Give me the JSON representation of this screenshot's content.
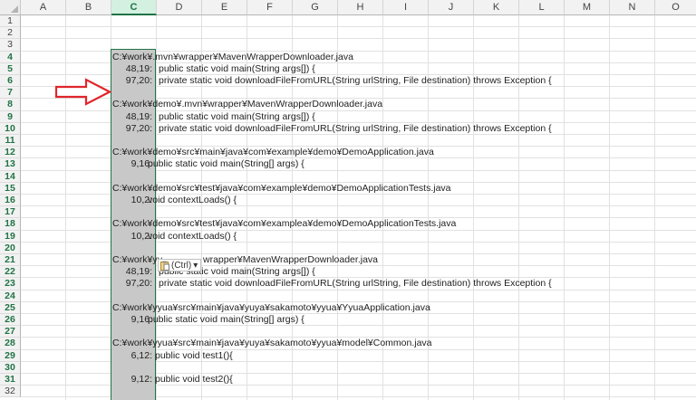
{
  "columns": [
    "A",
    "B",
    "C",
    "D",
    "E",
    "F",
    "G",
    "H",
    "I",
    "J",
    "K",
    "L",
    "M",
    "N",
    "O"
  ],
  "selected_column": "C",
  "rows": [
    {
      "n": "1"
    },
    {
      "n": "2"
    },
    {
      "n": "3"
    },
    {
      "n": "4",
      "path": "C:¥work¥.mvn¥wrapper¥MavenWrapperDownloader.java"
    },
    {
      "n": "5",
      "num": "48,19:",
      "code": "public static void main(String args[]) {",
      "indent": "m"
    },
    {
      "n": "6",
      "num": "97,20:",
      "code": "private static void downloadFileFromURL(String urlString, File destination) throws Exception {",
      "indent": "m"
    },
    {
      "n": "7"
    },
    {
      "n": "8",
      "path": "C:¥work¥demo¥.mvn¥wrapper¥MavenWrapperDownloader.java"
    },
    {
      "n": "9",
      "num": "48,19:",
      "code": "public static void main(String args[]) {",
      "indent": "m"
    },
    {
      "n": "10",
      "num": "97,20:",
      "code": "private static void downloadFileFromURL(String urlString, File destination) throws Exception {",
      "indent": "m"
    },
    {
      "n": "11"
    },
    {
      "n": "12",
      "path": "C:¥work¥demo¥src¥main¥java¥com¥example¥demo¥DemoApplication.java"
    },
    {
      "n": "13",
      "num": "9,16:",
      "code": "public static void main(String[] args) {",
      "indent": "s"
    },
    {
      "n": "14"
    },
    {
      "n": "15",
      "path": "C:¥work¥demo¥src¥test¥java¥com¥example¥demo¥DemoApplicationTests.java"
    },
    {
      "n": "16",
      "num": "10,2:",
      "code": "void contextLoads() {",
      "indent": "s"
    },
    {
      "n": "17"
    },
    {
      "n": "18",
      "path": "C:¥work¥demo¥src¥test¥java¥com¥examplea¥demo¥DemoApplicationTests.java"
    },
    {
      "n": "19",
      "num": "10,2:",
      "code": "void contextLoads() {",
      "indent": "s"
    },
    {
      "n": "20"
    },
    {
      "n": "21",
      "path": "C:¥work¥yu",
      "path2": "wrapper¥MavenWrapperDownloader.java"
    },
    {
      "n": "22",
      "num": "48,19:",
      "code": "public static void main(String args[]) {",
      "indent": "m"
    },
    {
      "n": "23",
      "num": "97,20:",
      "code": "private static void downloadFileFromURL(String urlString, File destination) throws Exception {",
      "indent": "m"
    },
    {
      "n": "24"
    },
    {
      "n": "25",
      "path": "C:¥work¥yyua¥src¥main¥java¥yuya¥sakamoto¥yyua¥YyuaApplication.java"
    },
    {
      "n": "26",
      "num": "9,16:",
      "code": "public static void main(String[] args) {",
      "indent": "s"
    },
    {
      "n": "27"
    },
    {
      "n": "28",
      "path": "C:¥work¥yyua¥src¥main¥java¥yuya¥sakamoto¥yyua¥model¥Common.java"
    },
    {
      "n": "29",
      "num": "6,12:",
      "code": "public void test1(){",
      "indent": "t"
    },
    {
      "n": "30"
    },
    {
      "n": "31",
      "num": "9,12:",
      "code": "public void test2(){",
      "indent": "t"
    },
    {
      "n": "32"
    }
  ],
  "paste_options": {
    "label": "(Ctrl)",
    "caret": "▾",
    "icon": "clipboard-icon"
  },
  "colors": {
    "accent": "#217346",
    "arrow": "#e0262b",
    "selection": "#c8c8c8"
  }
}
